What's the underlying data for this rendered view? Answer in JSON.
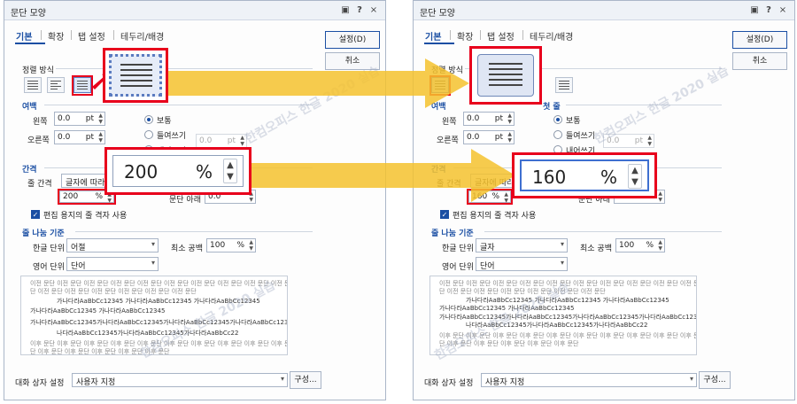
{
  "dialog": {
    "title": "문단 모양",
    "title_icons": [
      "box-icon",
      "help-icon",
      "close-icon"
    ],
    "help_glyph": "?",
    "close_glyph": "×",
    "tabs": [
      "기본",
      "확장",
      "탭 설정",
      "테두리/배경"
    ],
    "confirm_label": "설정(D)",
    "cancel_label": "취소",
    "alignment": {
      "label": "정렬 방식"
    },
    "margin": {
      "label": "여백",
      "left_label": "왼쪽",
      "left_value": "0.0",
      "left_unit": "pt",
      "right_label": "오른쪽",
      "right_value": "0.0",
      "right_unit": "pt"
    },
    "first_line": {
      "label": "첫 줄",
      "options": [
        "보통",
        "들여쓰기",
        "내어쓰기"
      ],
      "value": "0.0",
      "unit": "pt"
    },
    "spacing": {
      "label": "간격",
      "line_label": "줄 간격",
      "line_type": "글자에 따라",
      "para_below_label": "문단 아래",
      "para_below_value": "0.0",
      "grid_check_label": "편집 용지의 줄 격자 사용"
    },
    "line_break": {
      "label": "줄 나눔 기준",
      "korean_label": "한글 단위",
      "english_label": "영어 단위",
      "english_value": "단어",
      "min_space_label": "최소 공백",
      "min_space_value": "100",
      "min_space_unit": "%"
    },
    "preview_lines": [
      "이전 문단 이전 문단 이전 문단 이전 문단 이전 문단 이전 문단 이전 문단 이전 문단 이전 문단 이전 문",
      "단 이전 문단 이전 문단 이전 문단 이전 문단 이전 문단 이전 문단",
      "가나다라AaBbCc12345 가나다라AaBbCc12345 가나다라AaBbCc12345",
      "가나다라AaBbCc12345 가나다라AaBbCc12345",
      "가나다라AaBbCc12345가나다라AaBbCc12345가나다라AaBbCc12345가나다라AaBbCc12345가",
      "나다라AaBbCc12345가나다라AaBbCc12345가나다라AaBbCc22",
      "이후 문단 이후 문단 이후 문단 이후 문단 이후 문단 이후 문단 이후 문단 이후 문단 이후 문단 이후 문",
      "단 이후 문단 이후 문단 이후 문단 이후 문단 이후 문단"
    ],
    "footer": {
      "label": "대화 상자 설정",
      "value": "사용자 지정",
      "config_label": "구성..."
    }
  },
  "left": {
    "line_value": "200",
    "line_unit": "%",
    "korean_value": "어절",
    "zoom_value": "200",
    "zoom_unit": "%"
  },
  "right": {
    "line_value": "160",
    "line_unit": "%",
    "korean_value": "글자",
    "zoom_value": "160",
    "zoom_unit": "%"
  },
  "watermark": "한컴오피스 한글 2020 실습",
  "colors": {
    "highlight": "#e8001c",
    "arrow": "#f5c22e",
    "accent": "#1b4fa3"
  }
}
